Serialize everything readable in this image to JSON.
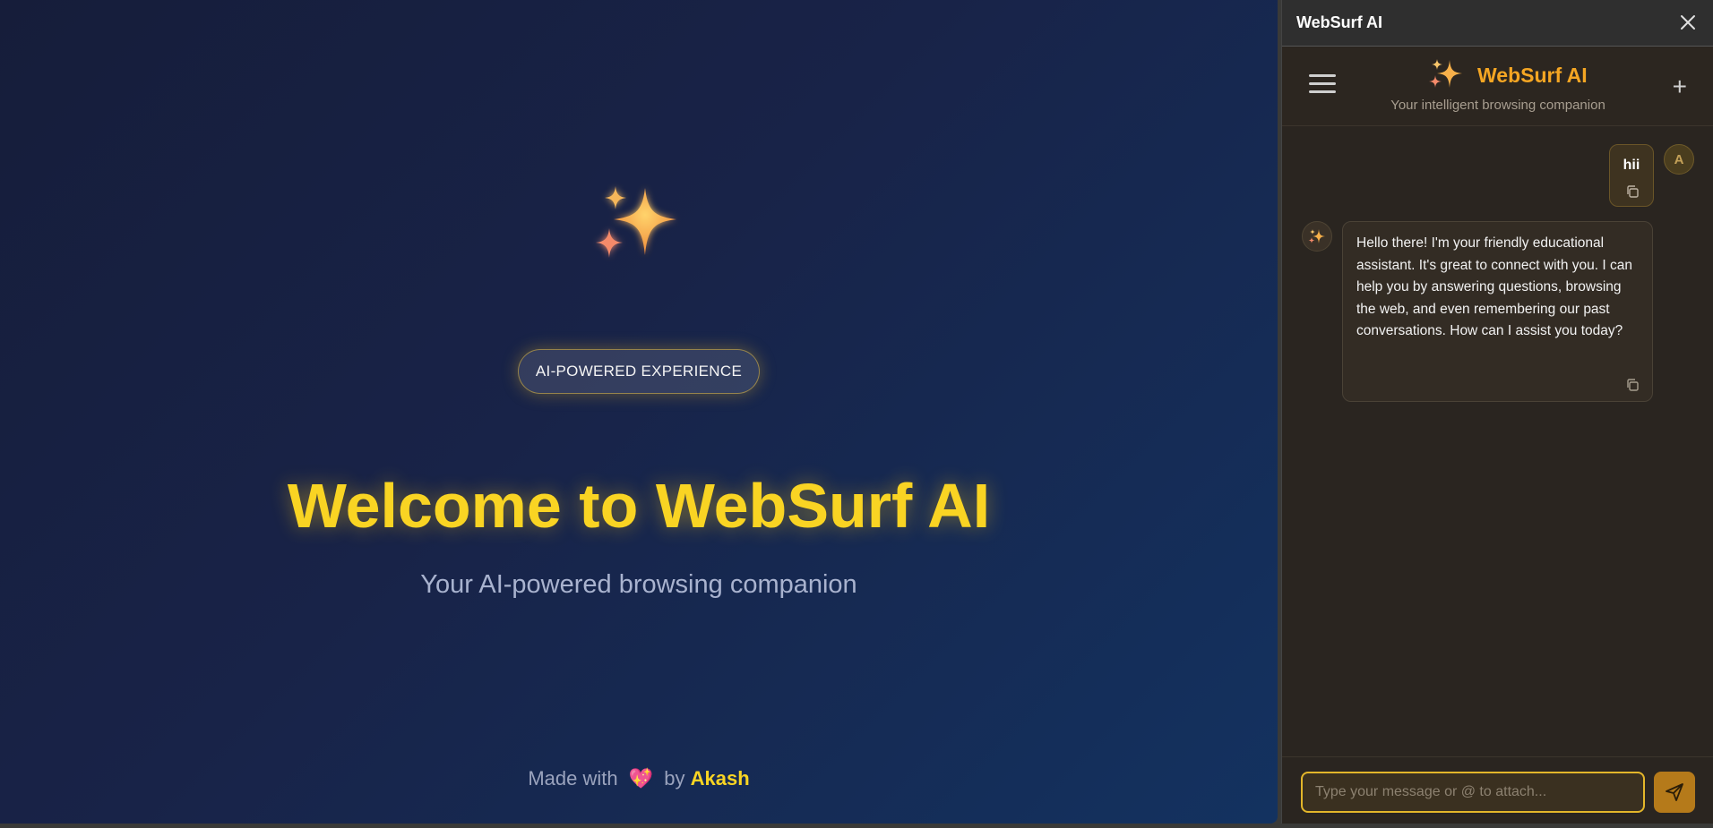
{
  "page": {
    "badge": "AI-POWERED EXPERIENCE",
    "welcome": "Welcome to WebSurf AI",
    "tagline": "Your AI-powered browsing companion",
    "footer": {
      "prefix": "Made with",
      "heart": "💖",
      "by": "by",
      "author": "Akash"
    }
  },
  "panel": {
    "window_title": "WebSurf AI",
    "brand": {
      "name": "WebSurf AI",
      "subtitle": "Your intelligent browsing companion"
    },
    "new_chat_label": "+",
    "messages": [
      {
        "role": "user",
        "avatar": "A",
        "text": "hii"
      },
      {
        "role": "assistant",
        "text": "Hello there! I'm your friendly educational assistant. It's great to connect with you. I can help you by answering questions, browsing the web, and even remembering our past conversations. How can I assist you today?"
      }
    ],
    "input": {
      "value": "",
      "placeholder": "Type your message or @ to attach..."
    }
  },
  "colors": {
    "accent": "#f9d423",
    "brand": "#f5a623",
    "panel_bg": "#2a2520"
  },
  "icons": [
    "sparkles-icon",
    "close-icon",
    "menu-icon",
    "plus-icon",
    "copy-icon",
    "send-icon"
  ]
}
